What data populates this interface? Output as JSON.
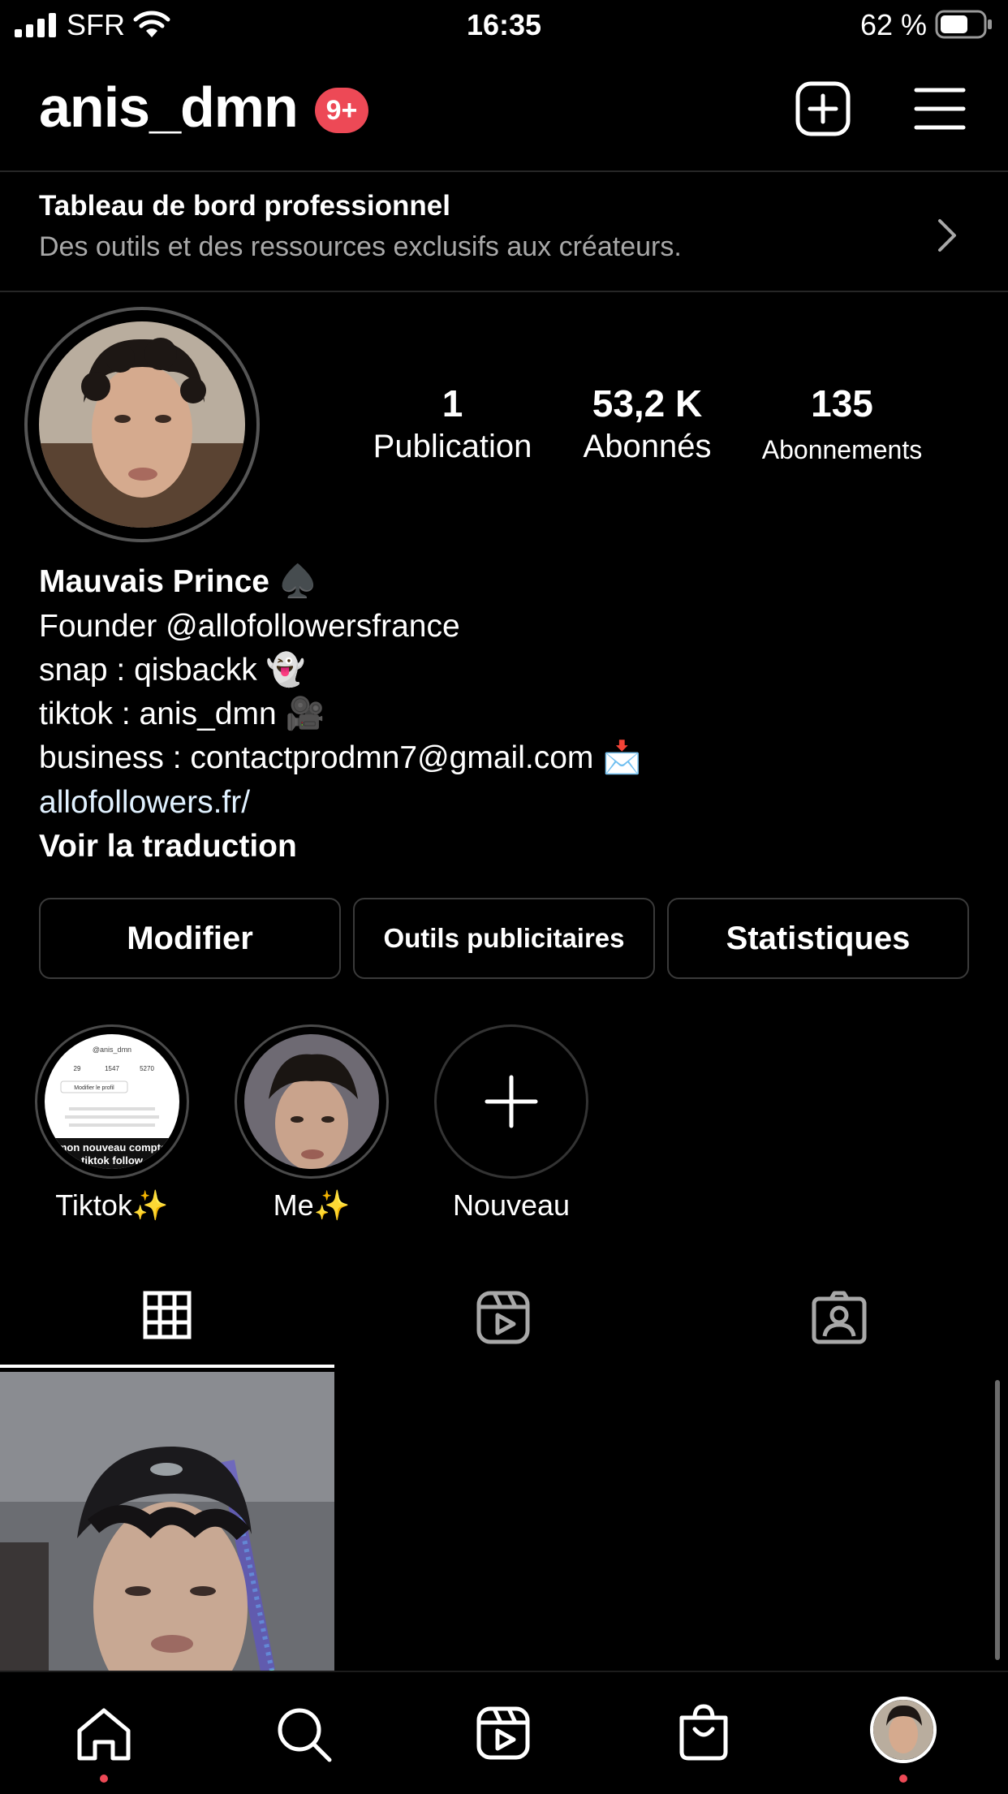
{
  "status_bar": {
    "carrier": "SFR",
    "time": "16:35",
    "battery_percent": "62 %"
  },
  "header": {
    "username": "anis_dmn",
    "notification_badge": "9+",
    "icons": [
      "create-post-icon",
      "menu-icon"
    ]
  },
  "pro_dashboard": {
    "title": "Tableau de bord professionnel",
    "subtitle": "Des outils et des ressources exclusifs aux créateurs."
  },
  "stats": {
    "posts": {
      "value": "1",
      "label": "Publication"
    },
    "followers": {
      "value": "53,2 K",
      "label": "Abonnés"
    },
    "following": {
      "value": "135",
      "label": "Abonnements"
    }
  },
  "bio": {
    "name": "Mauvais Prince ♠️",
    "line1": "Founder @allofollowersfrance",
    "line2": "snap : qisbackk 👻",
    "line3": "tiktok : anis_dmn 🎥",
    "line4": "business : contactprodmn7@gmail.com 📩",
    "link": "allofollowers.fr/",
    "translate": "Voir la traduction"
  },
  "buttons": {
    "edit": "Modifier",
    "ad_tools": "Outils publicitaires",
    "insights": "Statistiques"
  },
  "highlights": [
    {
      "label": "Tiktok✨"
    },
    {
      "label": "Me✨"
    },
    {
      "label": "Nouveau"
    }
  ],
  "highlight_thumb_text": {
    "handle": "@anis_dmn",
    "counts": [
      "29",
      "1547",
      "5270"
    ],
    "button": "Modifier le profil",
    "banner_line1": "mon nouveau compte",
    "banner_line2": "tiktok follow"
  },
  "tabs": [
    "grid-icon",
    "reels-icon",
    "tagged-icon"
  ],
  "bottom_nav": [
    "home-icon",
    "search-icon",
    "reels-icon",
    "shop-icon",
    "profile-avatar"
  ],
  "colors": {
    "background": "#000000",
    "badge": "#ed4956",
    "link": "#e0f1ff",
    "secondary_text": "#a8a8a8",
    "border": "#3a3a3a"
  }
}
